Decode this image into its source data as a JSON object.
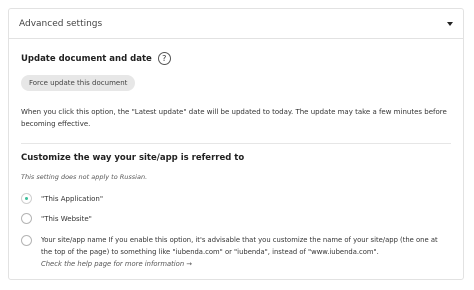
{
  "panel": {
    "title": "Advanced settings"
  },
  "update": {
    "title": "Update document and date",
    "help_glyph": "?",
    "button_label": "Force update this document",
    "description": "When you click this option, the \"Latest update\" date will be updated to today. The update may take a few minutes before becoming effective."
  },
  "customize": {
    "title": "Customize the way your site/app is referred to",
    "note": "This setting does not apply to Russian.",
    "options": [
      {
        "label": "\"This Application\"",
        "selected": true
      },
      {
        "label": "\"This Website\"",
        "selected": false
      },
      {
        "label": "Your site/app name If you enable this option, it's advisable that you customize the name of your site/app (the one at the top of the page) to something like \"iubenda.com\" or \"iubenda\", instead of \"www.iubenda.com\".",
        "selected": false
      }
    ],
    "help_link": "Check the help page for more information →"
  },
  "colors": {
    "accent": "#3fbf9b",
    "border": "#e2e2e2",
    "button_bg": "#e7e7e7"
  }
}
